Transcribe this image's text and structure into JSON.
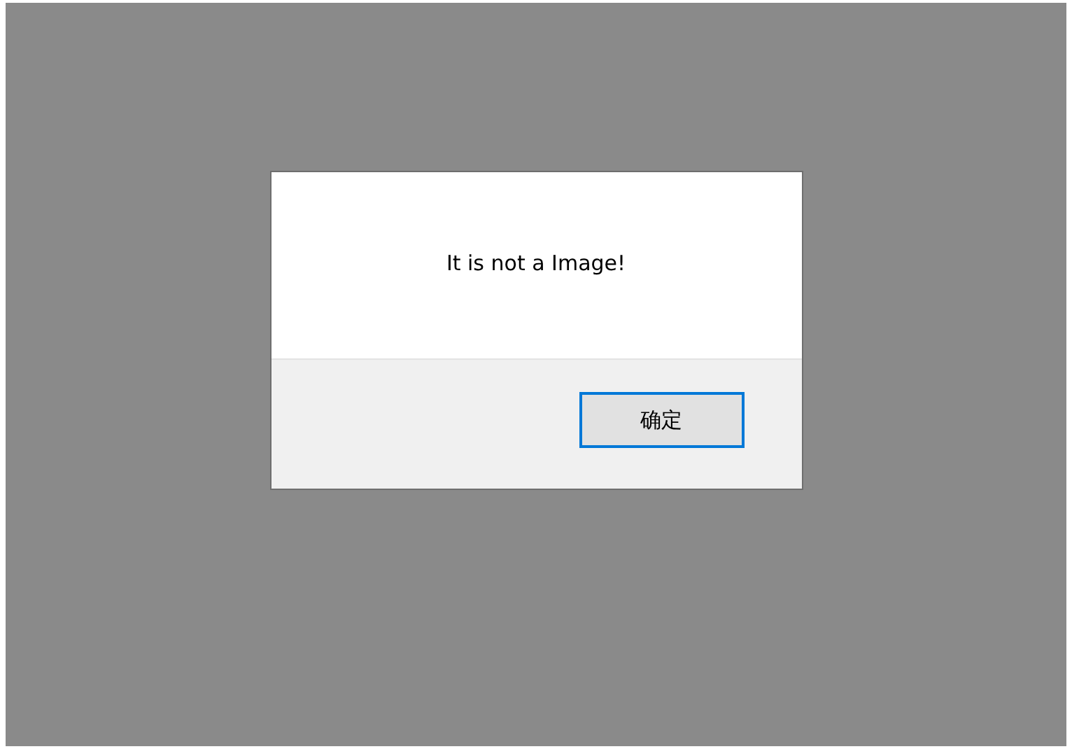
{
  "dialog": {
    "message": "It is not a Image!",
    "buttons": [
      {
        "label": "确定",
        "default": true
      }
    ]
  }
}
